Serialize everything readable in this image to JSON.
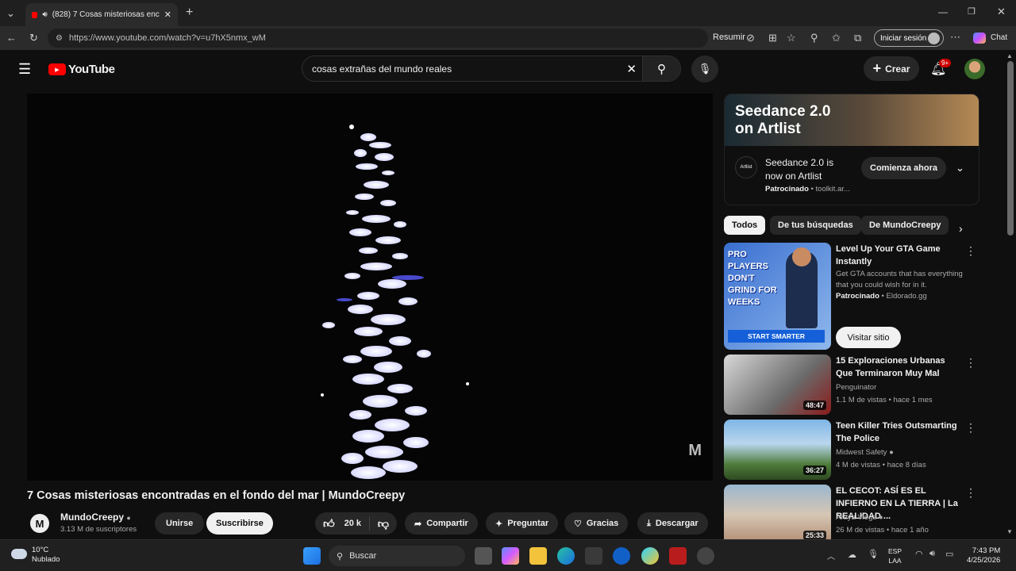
{
  "browser": {
    "tab_title": "(828) 7 Cosas misteriosas enc",
    "url": "https://www.youtube.com/watch?v=u7hX5nmx_wM",
    "resumir": "Resumir",
    "signin": "Iniciar sesión",
    "chat": "Chat"
  },
  "youtube": {
    "logo_text": "YouTube",
    "search_value": "cosas extrañas del mundo reales",
    "create": "Crear",
    "notif_badge": "9+"
  },
  "video": {
    "title": "7 Cosas misteriosas encontradas en el fondo del mar | MundoCreepy",
    "channel": "MundoCreepy",
    "subscribers": "3.13 M de suscriptores",
    "join": "Unirse",
    "subscribe": "Suscribirse",
    "likes": "20 k",
    "share": "Compartir",
    "ask": "Preguntar",
    "thanks": "Gracias",
    "download": "Descargar"
  },
  "ad": {
    "banner_line1": "Seedance 2.0",
    "banner_line2": "on Artlist",
    "brand": "Artlist",
    "title": "Seedance 2.0 is now on Artlist",
    "sponsored": "Patrocinado",
    "domain": "toolkit.ar...",
    "cta": "Comienza ahora"
  },
  "chips": [
    "Todos",
    "De tus búsquedas",
    "De MundoCreepy"
  ],
  "sponsored_video": {
    "title": "Level Up Your GTA Game Instantly",
    "desc": "Get GTA accounts that has everything that you could wish for in it.",
    "sponsored": "Patrocinado",
    "domain": "Eldorado.gg",
    "cta": "Visitar sitio",
    "thumb_text1": "PRO",
    "thumb_text2": "PLAYERS",
    "thumb_text3": "DON'T",
    "thumb_text4": "GRIND FOR",
    "thumb_text5": "WEEKS",
    "thumb_button": "START SMARTER"
  },
  "videos": [
    {
      "title": "15 Exploraciones Urbanas Que Terminaron Muy Mal",
      "channel": "Penguinator",
      "meta": "1.1 M de vistas • hace 1 mes",
      "duration": "48:47"
    },
    {
      "title": "Teen Killer Tries Outsmarting The Police",
      "channel": "Midwest Safety",
      "meta": "4 M de vistas • hace 8 días",
      "duration": "36:27"
    },
    {
      "title": "EL CECOT: ASÍ ES EL INFIERNO EN LA TIERRA | La REALIDAD ...",
      "channel": "Araya Vlogs",
      "meta": "26 M de vistas • hace 1 año",
      "duration": "25:33"
    }
  ],
  "taskbar": {
    "temp": "10°C",
    "weather": "Nublado",
    "search": "Buscar",
    "lang1": "ESP",
    "lang2": "LAA",
    "time": "7:43 PM",
    "date": "4/25/2026"
  }
}
